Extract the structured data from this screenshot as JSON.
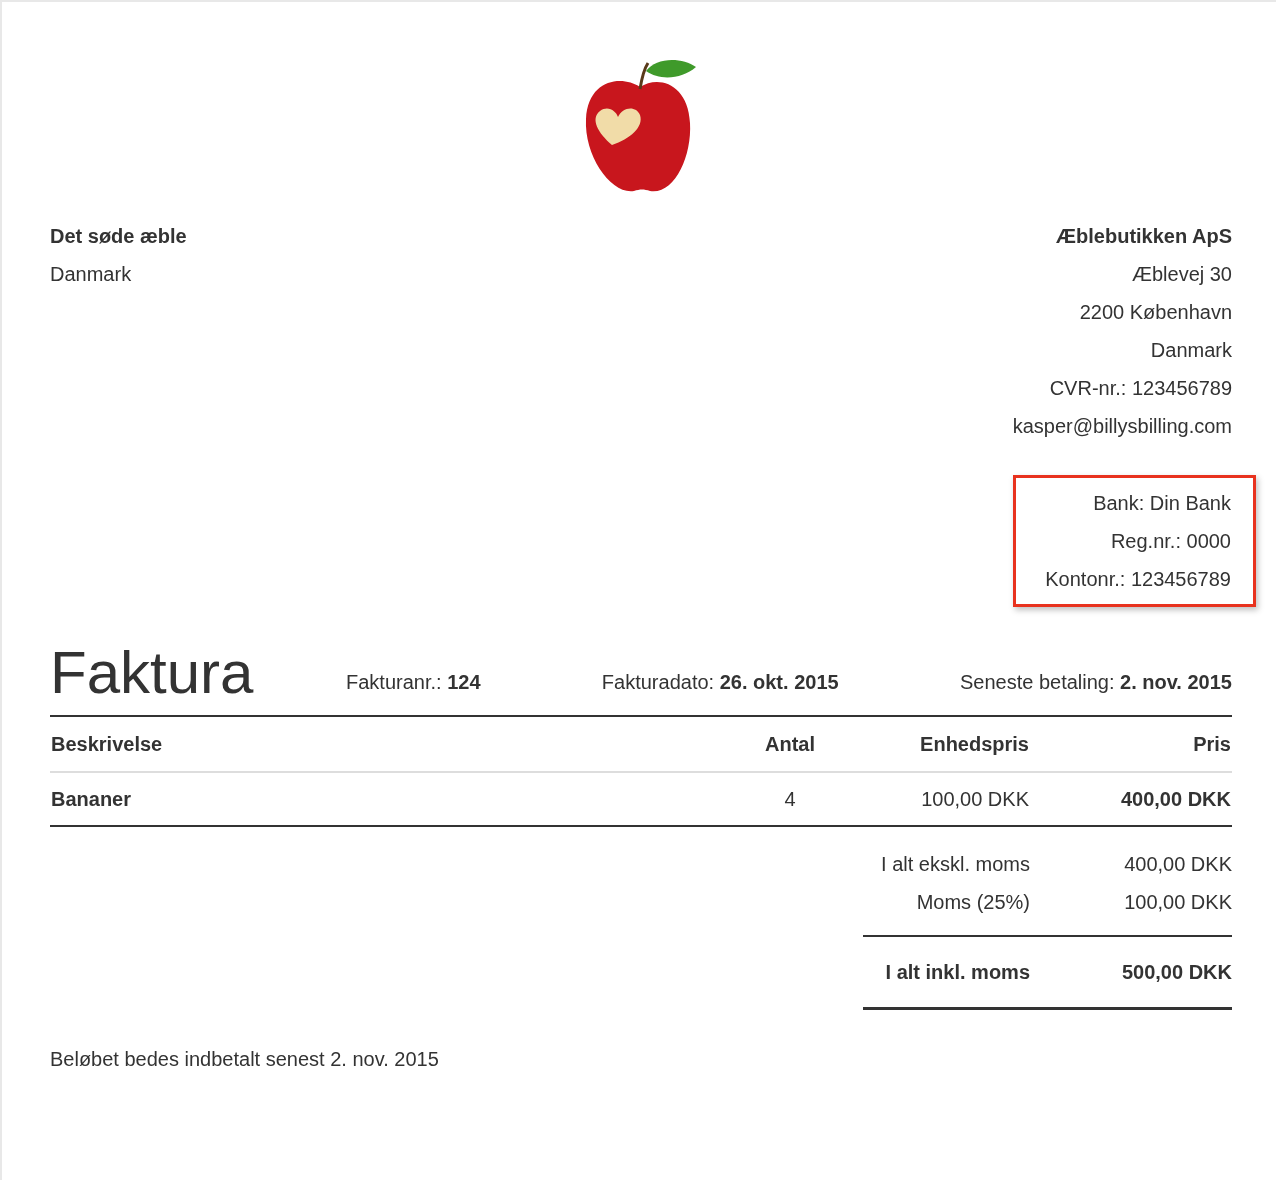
{
  "recipient": {
    "name": "Det søde æble",
    "lines": [
      "Danmark"
    ]
  },
  "sender": {
    "name": "Æblebutikken ApS",
    "lines": [
      "Æblevej 30",
      "2200 København",
      "Danmark",
      "CVR-nr.: 123456789",
      "kasper@billysbilling.com"
    ]
  },
  "bank": {
    "highlighted": true,
    "lines": [
      "Bank: Din Bank",
      "Reg.nr.: 0000",
      "Kontonr.: 123456789"
    ]
  },
  "invoice": {
    "title": "Faktura",
    "meta": [
      "Fakturanr.: **124**",
      "Fakturadato: **26. okt. 2015**",
      "Seneste betaling: **2. nov. 2015**"
    ]
  },
  "table": {
    "columns": [
      "Beskrivelse",
      "Antal",
      "Enhedspris",
      "Pris"
    ],
    "rows": [
      {
        "cells": [
          "Bananer",
          "4",
          "100,00 DKK",
          "400,00 DKK"
        ]
      }
    ]
  },
  "totals": [
    {
      "kind": "subtotal",
      "label": "I alt ekskl. moms",
      "value": "400,00 DKK"
    },
    {
      "kind": "subtotal",
      "label": "Moms (25%)",
      "value": "100,00 DKK"
    },
    {
      "kind": "total",
      "label": "I alt inkl. moms",
      "value": "500,00 DKK"
    }
  ],
  "footer_note": "Beløbet bedes indbetalt senest 2. nov. 2015"
}
